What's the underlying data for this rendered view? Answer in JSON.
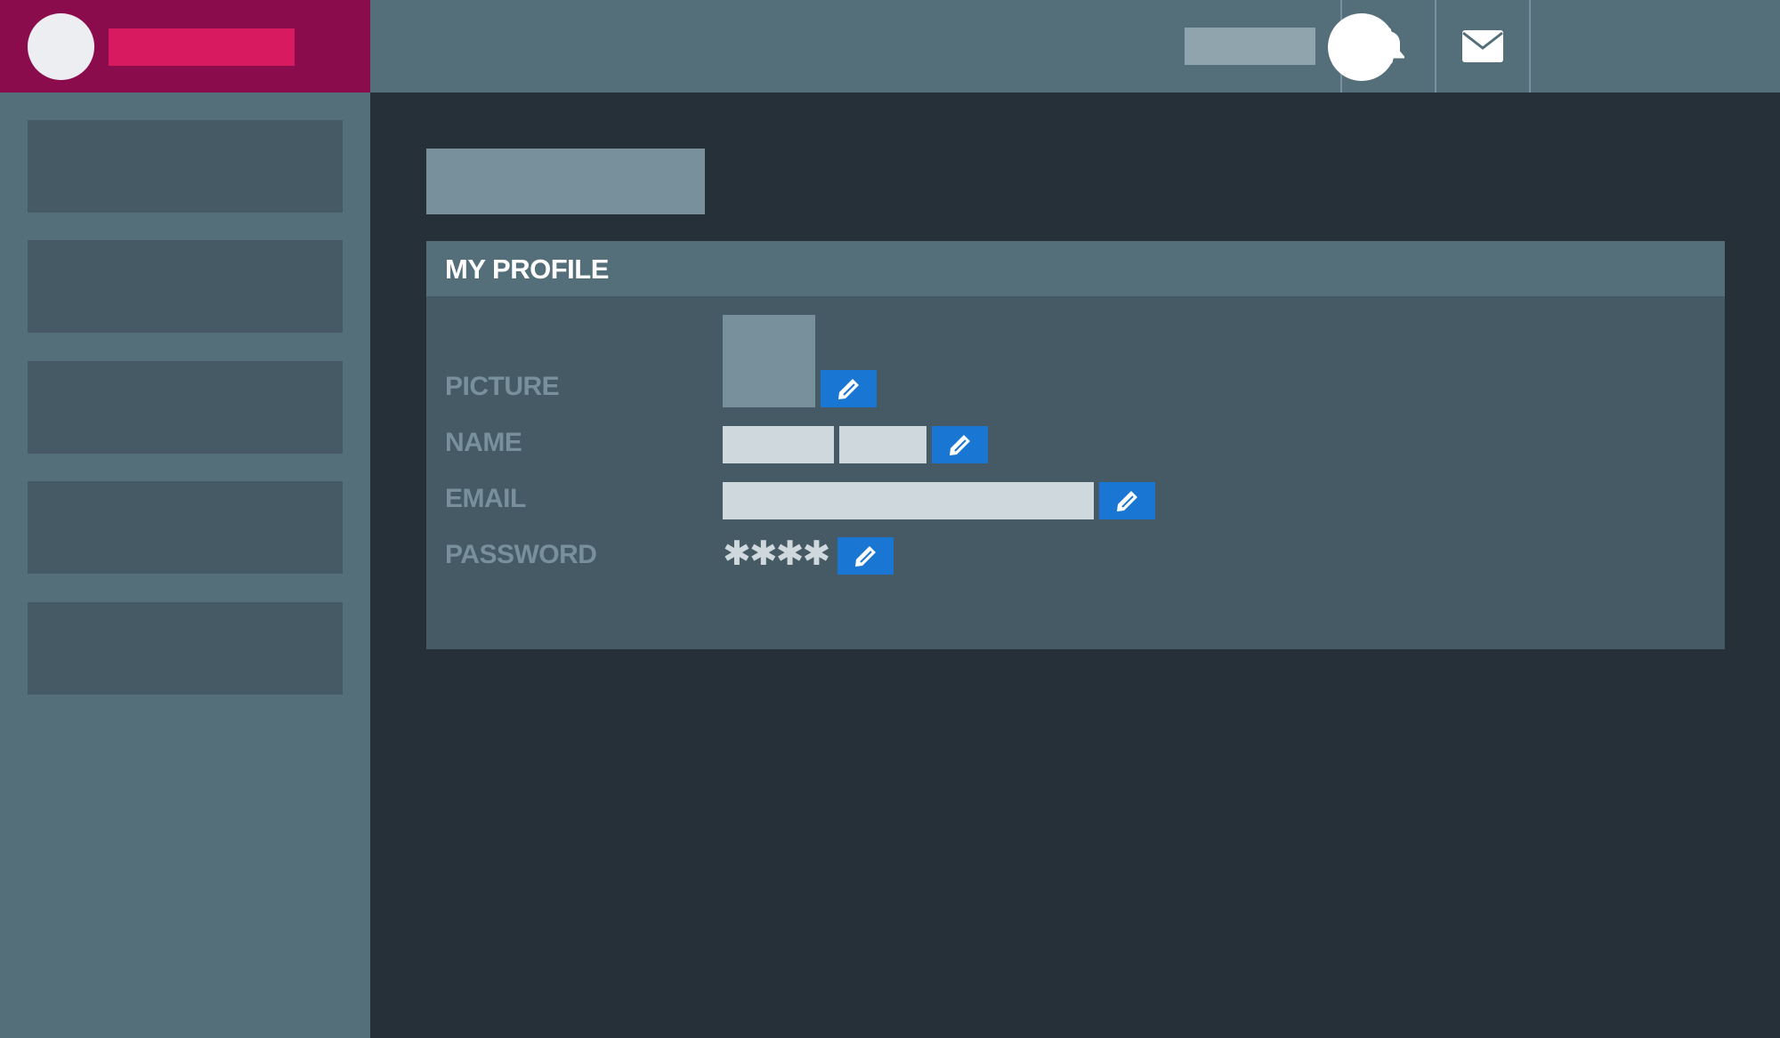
{
  "header": {
    "icons": {
      "notifications": "bell-icon",
      "messages": "envelope-icon",
      "edit": "pencil-icon"
    }
  },
  "profile_panel": {
    "title": "MY PROFILE",
    "rows": {
      "picture": {
        "label": "PICTURE"
      },
      "name": {
        "label": "NAME"
      },
      "email": {
        "label": "EMAIL"
      },
      "password": {
        "label": "PASSWORD",
        "masked_value": "✱✱✱✱"
      }
    }
  },
  "colors": {
    "brand_background": "#8b0c4d",
    "brand_accent": "#d81b60",
    "topbar": "#546e7a",
    "sidebar": "#546e7a",
    "main_background": "#253038",
    "panel": "#455a64",
    "edit_button": "#1976d2",
    "label_text": "#78909c"
  }
}
